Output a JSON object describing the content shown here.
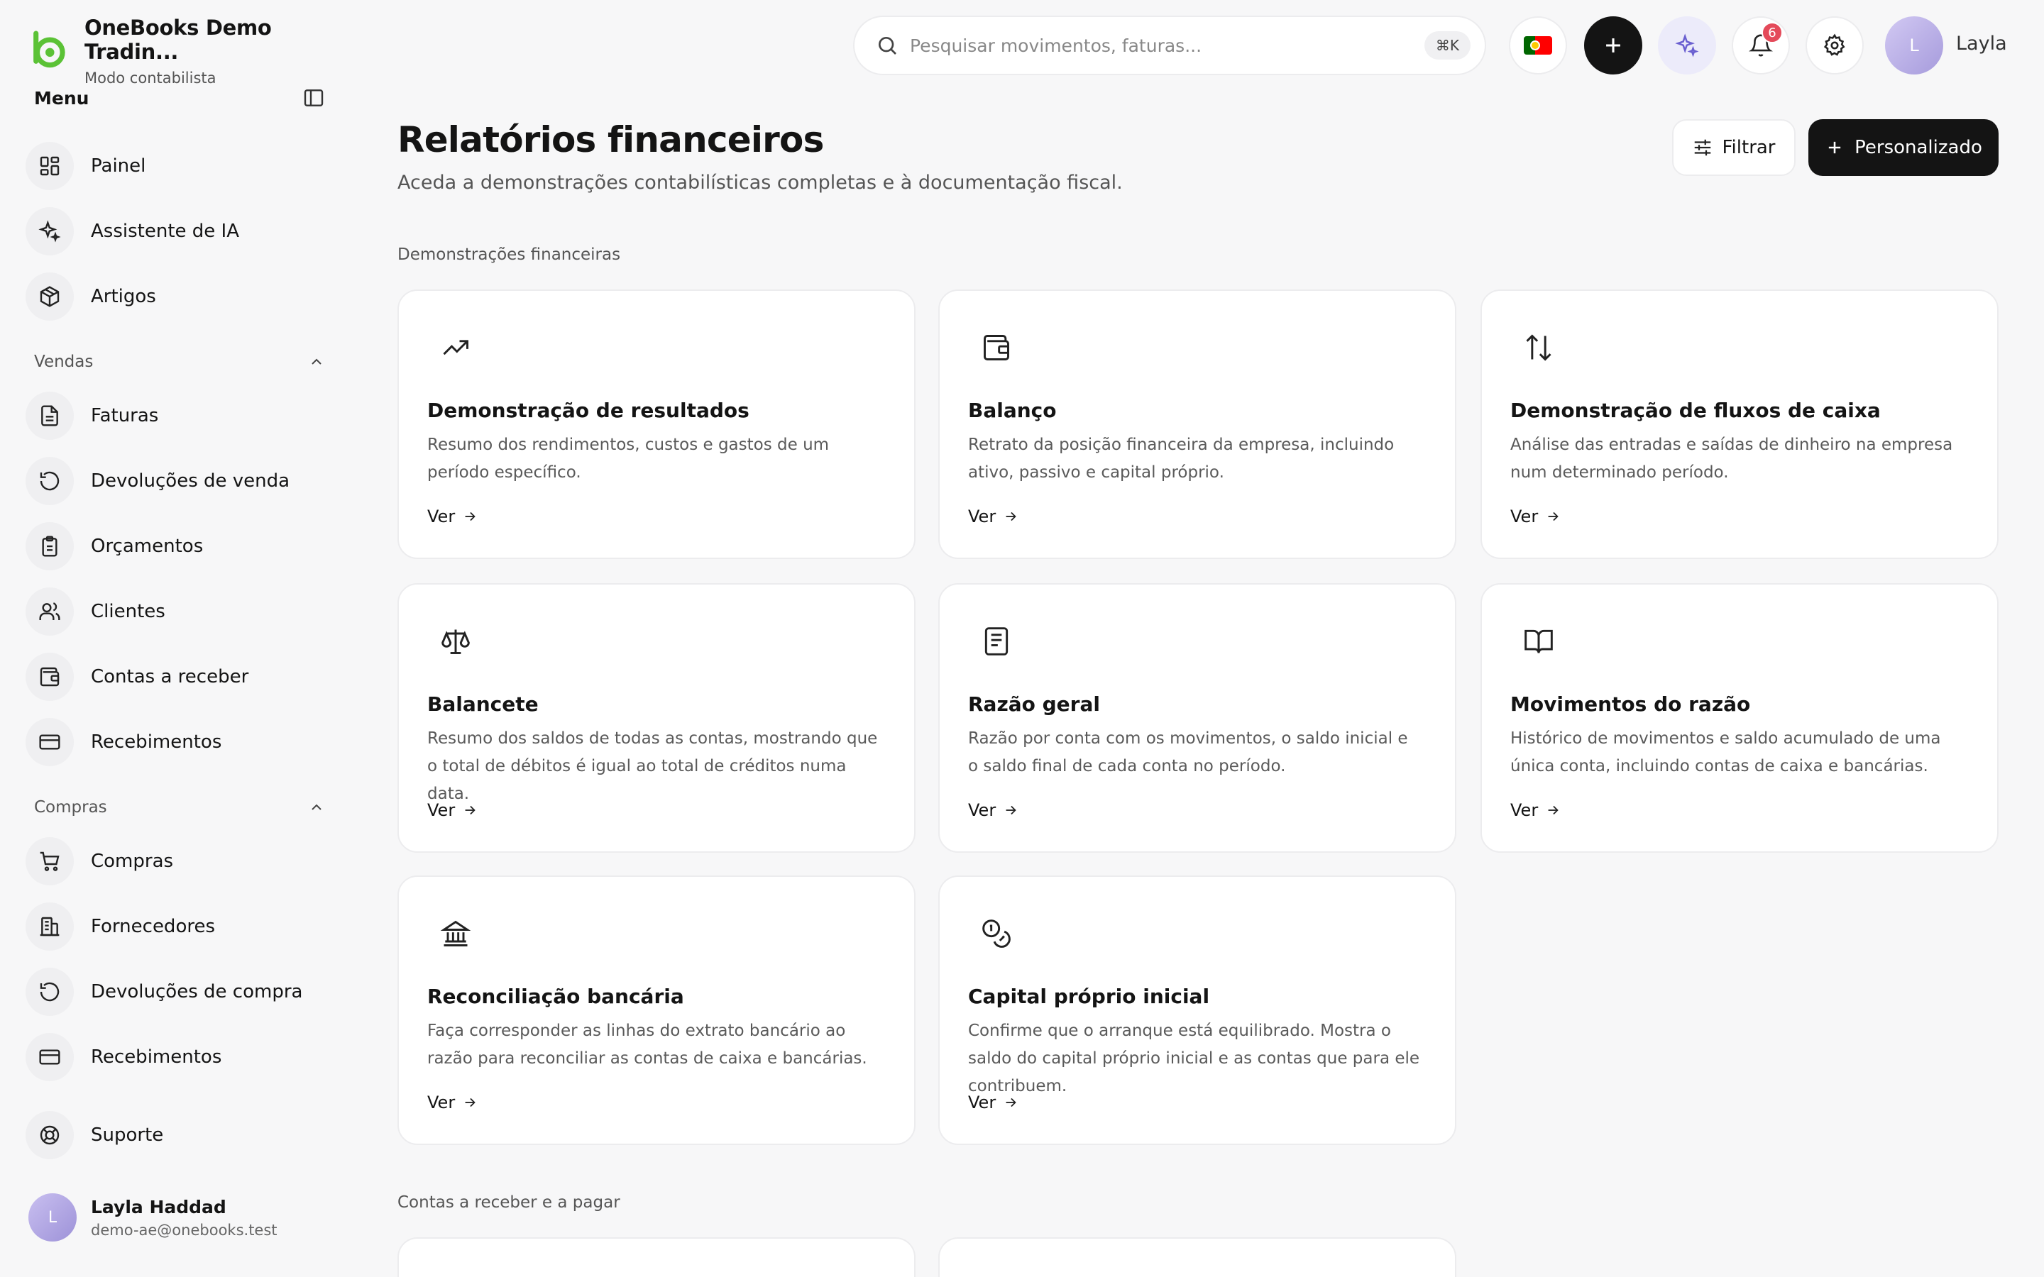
{
  "brand": {
    "name": "OneBooks Demo Tradin...",
    "subtitle": "Modo contabilista"
  },
  "sidebar": {
    "menu_label": "Menu",
    "top_items": [
      {
        "label": "Painel",
        "icon": "dashboard-icon"
      },
      {
        "label": "Assistente de IA",
        "icon": "sparkles-icon"
      },
      {
        "label": "Artigos",
        "icon": "box-icon"
      }
    ],
    "sales": {
      "label": "Vendas",
      "items": [
        {
          "label": "Faturas",
          "icon": "file-text-icon"
        },
        {
          "label": "Devoluções de venda",
          "icon": "rotate-ccw-icon"
        },
        {
          "label": "Orçamentos",
          "icon": "clipboard-icon"
        },
        {
          "label": "Clientes",
          "icon": "users-icon"
        },
        {
          "label": "Contas a receber",
          "icon": "wallet-icon"
        },
        {
          "label": "Recebimentos",
          "icon": "credit-card-icon"
        }
      ]
    },
    "purchases": {
      "label": "Compras",
      "items": [
        {
          "label": "Compras",
          "icon": "cart-icon"
        },
        {
          "label": "Fornecedores",
          "icon": "building-icon"
        },
        {
          "label": "Devoluções de compra",
          "icon": "rotate-ccw-icon"
        },
        {
          "label": "Recebimentos",
          "icon": "credit-card-icon"
        }
      ]
    },
    "support": {
      "label": "Suporte",
      "icon": "lifebuoy-icon"
    },
    "user": {
      "initial": "L",
      "name": "Layla Haddad",
      "email": "demo-ae@onebooks.test"
    }
  },
  "header": {
    "search_placeholder": "Pesquisar movimentos, faturas...",
    "search_shortcut": "⌘K",
    "notification_count": "6",
    "user_initial": "L",
    "user_name": "Layla"
  },
  "main": {
    "title": "Relatórios financeiros",
    "subtitle": "Aceda a demonstrações contabilísticas completas e à documentação fiscal.",
    "filter_label": "Filtrar",
    "custom_label": "Personalizado",
    "sections": [
      {
        "label": "Demonstrações financeiras",
        "cards": [
          {
            "title": "Demonstração de resultados",
            "description": "Resumo dos rendimentos, custos e gastos de um período específico.",
            "link": "Ver",
            "icon": "trending-up-icon"
          },
          {
            "title": "Balanço",
            "description": "Retrato da posição financeira da empresa, incluindo ativo, passivo e capital próprio.",
            "link": "Ver",
            "icon": "wallet-icon"
          },
          {
            "title": "Demonstração de fluxos de caixa",
            "description": "Análise das entradas e saídas de dinheiro na empresa num determinado período.",
            "link": "Ver",
            "icon": "arrows-up-down-icon"
          },
          {
            "title": "Balancete",
            "description": "Resumo dos saldos de todas as contas, mostrando que o total de débitos é igual ao total de créditos numa data.",
            "link": "Ver",
            "icon": "scale-icon"
          },
          {
            "title": "Razão geral",
            "description": "Razão por conta com os movimentos, o saldo inicial e o saldo final de cada conta no período.",
            "link": "Ver",
            "icon": "book-text-icon"
          },
          {
            "title": "Movimentos do razão",
            "description": "Histórico de movimentos e saldo acumulado de uma única conta, incluindo contas de caixa e bancárias.",
            "link": "Ver",
            "icon": "book-open-icon"
          },
          {
            "title": "Reconciliação bancária",
            "description": "Faça corresponder as linhas do extrato bancário ao razão para reconciliar as contas de caixa e bancárias.",
            "link": "Ver",
            "icon": "bank-icon"
          },
          {
            "title": "Capital próprio inicial",
            "description": "Confirme que o arranque está equilibrado. Mostra o saldo do capital próprio inicial e as contas que para ele contribuem.",
            "link": "Ver",
            "icon": "coins-icon"
          }
        ]
      },
      {
        "label": "Contas a receber e a pagar"
      }
    ]
  },
  "colors": {
    "accent": "#5bc236",
    "primary": "#141414",
    "badge": "#e44a5a",
    "flag_green": "#006600",
    "flag_red": "#ff0000"
  }
}
